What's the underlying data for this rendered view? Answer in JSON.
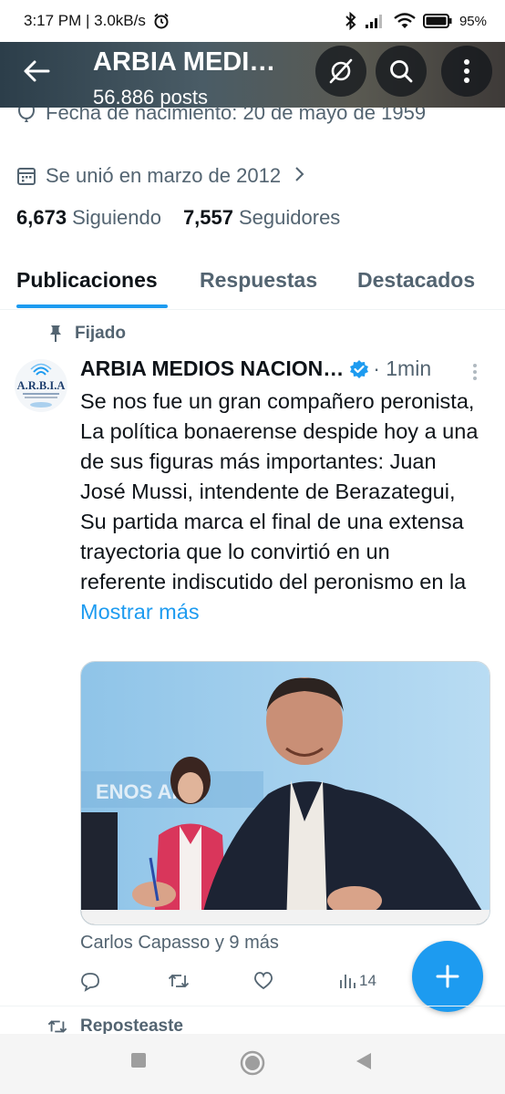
{
  "status_bar": {
    "time": "3:17 PM | 3.0kB/s",
    "battery": "95%"
  },
  "header": {
    "title": "ARBIA MEDI…",
    "posts_count": "56.886 posts"
  },
  "profile": {
    "birth": "Fecha de nacimiento: 20 de mayo de 1959",
    "joined": "Se unió en marzo de 2012",
    "following_count": "6,673",
    "following_label": "Siguiendo",
    "followers_count": "7,557",
    "followers_label": "Seguidores"
  },
  "tabs": [
    {
      "label": "Publicaciones"
    },
    {
      "label": "Respuestas"
    },
    {
      "label": "Destacados"
    }
  ],
  "pinned_label": "Fijado",
  "post": {
    "avatar_text": "A.R.B.I.A",
    "author": "ARBIA MEDIOS NACION…",
    "time": "· 1min",
    "body": "Se nos fue un gran compañero peronista, La política bonaerense despide hoy a una de sus figuras más importantes: Juan José Mussi, intendente de Berazategui, Su partida marca el final de una extensa trayectoria que lo convirtió en un referente indiscutido del peronismo en la ",
    "show_more": "Mostrar más",
    "image_banner_text": "ENOS AIRE",
    "likers": "Carlos Capasso y 9 más",
    "views": "14"
  },
  "reposted_label": "Reposteaste",
  "colors": {
    "accent": "#1d9bf0",
    "text_secondary": "#536471",
    "verified": "#1d9bf0"
  }
}
